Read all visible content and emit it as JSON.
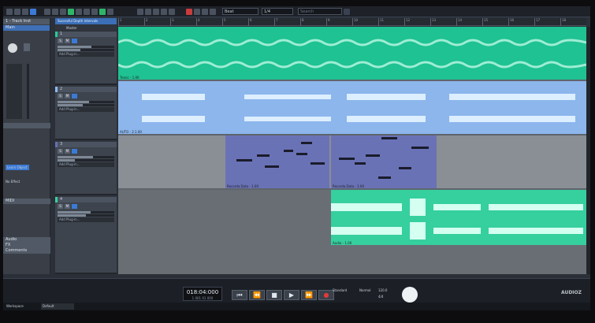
{
  "toolbar": {
    "position_select": "Beat",
    "search_placeholder": "Search",
    "grid_select": "1/4"
  },
  "tabs": {
    "song_tab": "Sucessful Depth Intervals"
  },
  "inspector": {
    "track_select": "1 - Track Inst",
    "main_label": "Main",
    "section_midi": "MIDI",
    "section_audio": "Audio",
    "section_fx": "FX",
    "section_comments": "Comments",
    "learn_button": "Learn Object",
    "no_effect": "No Effect"
  },
  "tracks": [
    {
      "num": "1",
      "name": "T1",
      "plug": "Add Plug-in...",
      "color": "#29c99a"
    },
    {
      "num": "2",
      "name": "T2",
      "plug": "Add Plug-in...",
      "color": "#8fb8ef"
    },
    {
      "num": "3",
      "name": "T3",
      "plug": "Add Plug-in...",
      "color": "#6770b2"
    },
    {
      "num": "4",
      "name": "T4",
      "plug": "Add Plug-in...",
      "color": "#39d1a1"
    }
  ],
  "master": {
    "label": "Master"
  },
  "ruler": [
    "1",
    "2",
    "3",
    "4",
    "5",
    "6",
    "7",
    "8",
    "9",
    "10",
    "11",
    "12",
    "13",
    "14",
    "15",
    "16",
    "17",
    "18"
  ],
  "clips": [
    {
      "label": "Tronic - 1.00"
    },
    {
      "label": "AUTO - 2.1.00"
    },
    {
      "label": "Recorda Data - 1.00"
    },
    {
      "label": "Recorda Data - 1.00"
    },
    {
      "label": "Audio - 1.00"
    }
  ],
  "transport": {
    "time": "018:04:000",
    "sub_time": "1 001 01 000",
    "tempo_label": "Standard",
    "normal_label": "Normal",
    "tempo": "120.0",
    "key": "4/4",
    "workspace_label": "Workspace",
    "workspace_value": "Default"
  },
  "watermark": "AUDIOZ"
}
